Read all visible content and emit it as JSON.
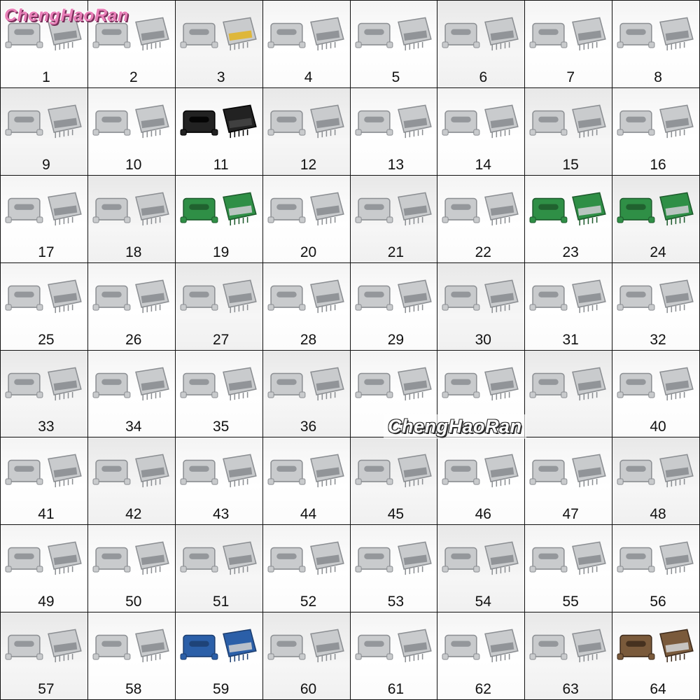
{
  "brand": {
    "top_logo": "ChengHaoRan",
    "center_logo": "ChengHaoRan"
  },
  "colors": {
    "metal": "#c9cbcd",
    "metal_dark": "#8b8e92",
    "black_plastic": "#222222",
    "gold": "#e0b52b",
    "pcb_green": "#2f8f46",
    "pcb_blue": "#2b5fa8",
    "copper": "#7a5a3b"
  },
  "items": [
    {
      "label": "1",
      "style": "metal"
    },
    {
      "label": "2",
      "style": "metal"
    },
    {
      "label": "3",
      "style": "gold"
    },
    {
      "label": "4",
      "style": "metal"
    },
    {
      "label": "5",
      "style": "metal"
    },
    {
      "label": "6",
      "style": "metal"
    },
    {
      "label": "7",
      "style": "metal"
    },
    {
      "label": "8",
      "style": "metal"
    },
    {
      "label": "9",
      "style": "metal"
    },
    {
      "label": "10",
      "style": "metal"
    },
    {
      "label": "11",
      "style": "black"
    },
    {
      "label": "12",
      "style": "metal"
    },
    {
      "label": "13",
      "style": "metal"
    },
    {
      "label": "14",
      "style": "metal"
    },
    {
      "label": "15",
      "style": "metal"
    },
    {
      "label": "16",
      "style": "metal"
    },
    {
      "label": "17",
      "style": "metal"
    },
    {
      "label": "18",
      "style": "metal"
    },
    {
      "label": "19",
      "style": "green"
    },
    {
      "label": "20",
      "style": "plug"
    },
    {
      "label": "21",
      "style": "metal"
    },
    {
      "label": "22",
      "style": "metal"
    },
    {
      "label": "23",
      "style": "green"
    },
    {
      "label": "24",
      "style": "green"
    },
    {
      "label": "25",
      "style": "metal"
    },
    {
      "label": "26",
      "style": "metal"
    },
    {
      "label": "27",
      "style": "metal"
    },
    {
      "label": "28",
      "style": "metal"
    },
    {
      "label": "29",
      "style": "metal"
    },
    {
      "label": "30",
      "style": "metal"
    },
    {
      "label": "31",
      "style": "metal"
    },
    {
      "label": "32",
      "style": "metal"
    },
    {
      "label": "33",
      "style": "metal"
    },
    {
      "label": "34",
      "style": "metal"
    },
    {
      "label": "35",
      "style": "metal"
    },
    {
      "label": "36",
      "style": "metal"
    },
    {
      "label": "",
      "style": "metal"
    },
    {
      "label": "",
      "style": "metal"
    },
    {
      "label": "",
      "style": "metal"
    },
    {
      "label": "40",
      "style": "metal"
    },
    {
      "label": "41",
      "style": "metal"
    },
    {
      "label": "42",
      "style": "metal"
    },
    {
      "label": "43",
      "style": "metal"
    },
    {
      "label": "44",
      "style": "metal"
    },
    {
      "label": "45",
      "style": "metal"
    },
    {
      "label": "46",
      "style": "metal"
    },
    {
      "label": "47",
      "style": "metal"
    },
    {
      "label": "48",
      "style": "metal"
    },
    {
      "label": "49",
      "style": "metal"
    },
    {
      "label": "50",
      "style": "metal"
    },
    {
      "label": "51",
      "style": "metal"
    },
    {
      "label": "52",
      "style": "metal"
    },
    {
      "label": "53",
      "style": "metal"
    },
    {
      "label": "54",
      "style": "metal"
    },
    {
      "label": "55",
      "style": "metal"
    },
    {
      "label": "56",
      "style": "metal"
    },
    {
      "label": "57",
      "style": "metal"
    },
    {
      "label": "58",
      "style": "metal"
    },
    {
      "label": "59",
      "style": "blue"
    },
    {
      "label": "60",
      "style": "metal"
    },
    {
      "label": "61",
      "style": "metal"
    },
    {
      "label": "62",
      "style": "metal"
    },
    {
      "label": "63",
      "style": "metal"
    },
    {
      "label": "64",
      "style": "copper"
    }
  ]
}
